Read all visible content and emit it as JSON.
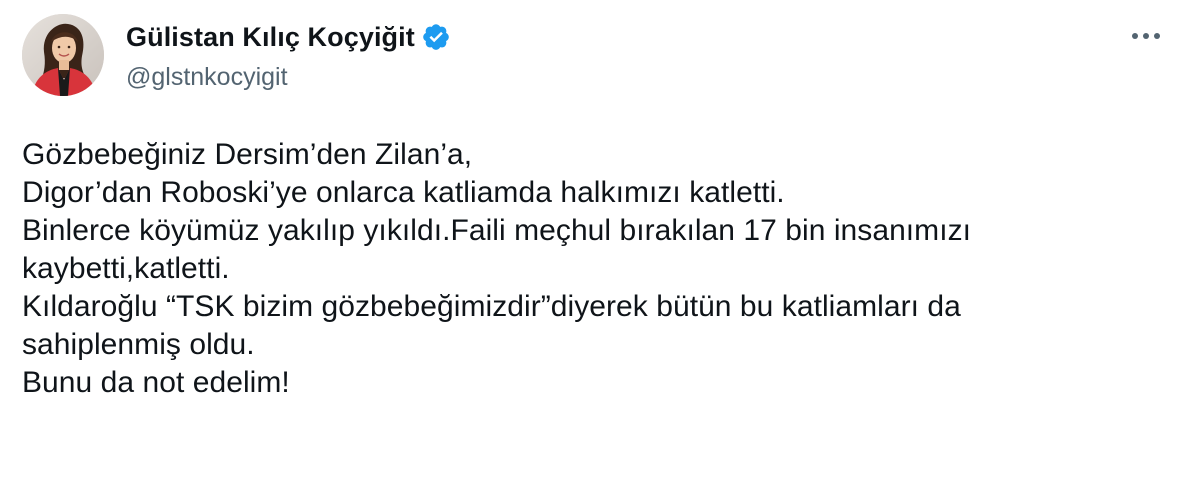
{
  "author": {
    "display_name": "Gülistan Kılıç Koçyiğit",
    "handle": "@glstnkocyigit",
    "verified": true,
    "avatar_icon": "profile-photo-avatar",
    "verified_icon": "verified-badge-icon",
    "verified_color": "#1d9bf0"
  },
  "menu": {
    "icon": "more-options-icon"
  },
  "tweet": {
    "lines": [
      "Gözbebeğiniz Dersim’den Zilan’a,",
      "Digor’dan Roboski’ye onlarca katliamda halkımızı katletti.",
      "Binlerce köyümüz yakılıp yıkıldı.Faili meçhul bırakılan 17 bin insanımızı",
      "kaybetti,katletti.",
      "Kıldaroğlu “TSK bizim gözbebeğimizdir”diyerek bütün bu katliamları da",
      "sahiplenmiş oldu.",
      "Bunu da not edelim!"
    ]
  },
  "colors": {
    "text_primary": "#0f1419",
    "text_secondary": "#536471",
    "background": "#ffffff"
  }
}
